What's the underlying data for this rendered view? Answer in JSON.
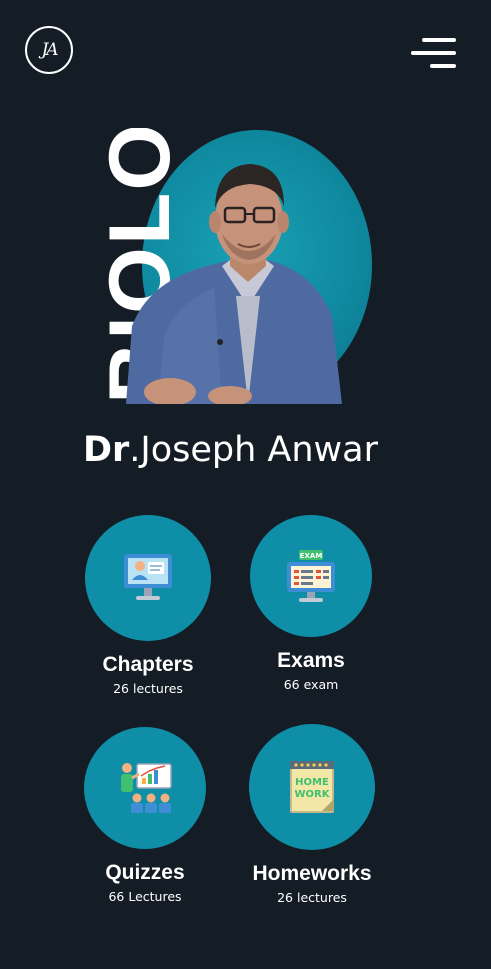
{
  "header": {
    "logo_text": "JA",
    "menu_icon": "hamburger-menu-icon"
  },
  "hero": {
    "subject_word": "BIOLOGY",
    "circle_color": "#0e8fa7"
  },
  "doctor": {
    "prefix": "Dr",
    "name": ".Joseph Anwar"
  },
  "cards": [
    {
      "title": "Chapters",
      "subtitle": "26 lectures",
      "icon": "computer-lecture-icon"
    },
    {
      "title": "Exams",
      "subtitle": "66 exam",
      "icon": "exam-monitor-icon"
    },
    {
      "title": "Quizzes",
      "subtitle": "66 Lectures",
      "icon": "classroom-presentation-icon"
    },
    {
      "title": "Homeworks",
      "subtitle": "26 lectures",
      "icon": "homework-notebook-icon"
    }
  ],
  "colors": {
    "background": "#141c25",
    "accent": "#0e8fa7",
    "text": "#ffffff"
  }
}
